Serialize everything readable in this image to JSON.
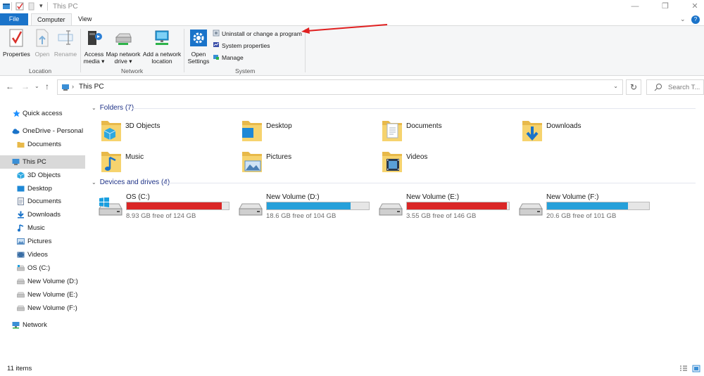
{
  "window": {
    "title": "This PC",
    "controls": [
      "minimize-icon",
      "restore-icon",
      "close-icon"
    ]
  },
  "ribbon": {
    "tabs": [
      {
        "label": "File",
        "state": "file"
      },
      {
        "label": "Computer",
        "state": "active"
      },
      {
        "label": "View",
        "state": "normal"
      }
    ],
    "groups": {
      "location": {
        "label": "Location",
        "buttons": [
          {
            "label": "Properties",
            "icon": "properties-icon",
            "enabled": true
          },
          {
            "label": "Open",
            "icon": "open-icon",
            "enabled": false
          },
          {
            "label": "Rename",
            "icon": "rename-icon",
            "enabled": false
          }
        ]
      },
      "network": {
        "label": "Network",
        "buttons": [
          {
            "line1": "Access",
            "line2": "media ▾",
            "icon": "access-media-icon"
          },
          {
            "line1": "Map network",
            "line2": "drive ▾",
            "icon": "map-drive-icon"
          },
          {
            "line1": "Add a network",
            "line2": "location",
            "icon": "network-location-icon"
          }
        ]
      },
      "system": {
        "label": "System",
        "open_settings": {
          "line1": "Open",
          "line2": "Settings",
          "icon": "gear-icon"
        },
        "commands": [
          {
            "label": "Uninstall or change a program",
            "icon": "uninstall-icon"
          },
          {
            "label": "System properties",
            "icon": "system-properties-icon"
          },
          {
            "label": "Manage",
            "icon": "manage-icon"
          }
        ]
      }
    }
  },
  "address": {
    "location": "This PC",
    "search_placeholder": "Search T..."
  },
  "sidebar": {
    "items": [
      {
        "label": "Quick access",
        "icon": "star-icon",
        "color": "#1e90ff"
      },
      {
        "label": "OneDrive - Personal",
        "icon": "cloud-icon",
        "color": "#1a73c9"
      },
      {
        "label": "Documents",
        "icon": "folder-icon",
        "color": "#e8b94a"
      },
      {
        "label": "This PC",
        "icon": "computer-icon",
        "color": "#3a8fd6"
      },
      {
        "label": "3D Objects",
        "icon": "cube-icon",
        "color": "#2ea8e0"
      },
      {
        "label": "Desktop",
        "icon": "desktop-icon",
        "color": "#1e88d6"
      },
      {
        "label": "Documents",
        "icon": "documents-icon",
        "color": "#7a8aa3"
      },
      {
        "label": "Downloads",
        "icon": "download-icon",
        "color": "#1a73c9"
      },
      {
        "label": "Music",
        "icon": "music-icon",
        "color": "#1a73c9"
      },
      {
        "label": "Pictures",
        "icon": "pictures-icon",
        "color": "#5b8fc4"
      },
      {
        "label": "Videos",
        "icon": "videos-icon",
        "color": "#3a6ea5"
      },
      {
        "label": "OS (C:)",
        "icon": "drive-icon",
        "color": "#9aa3ad"
      },
      {
        "label": "New Volume (D:)",
        "icon": "drive-icon",
        "color": "#9aa3ad"
      },
      {
        "label": "New Volume (E:)",
        "icon": "drive-icon",
        "color": "#9aa3ad"
      },
      {
        "label": "New Volume (F:)",
        "icon": "drive-icon",
        "color": "#9aa3ad"
      },
      {
        "label": "Network",
        "icon": "network-icon",
        "color": "#3a8fd6"
      }
    ]
  },
  "folders_section": {
    "heading": "Folders (7)",
    "items": [
      {
        "label": "3D Objects",
        "icon": "3d-objects-folder-icon"
      },
      {
        "label": "Desktop",
        "icon": "desktop-folder-icon"
      },
      {
        "label": "Documents",
        "icon": "documents-folder-icon"
      },
      {
        "label": "Downloads",
        "icon": "downloads-folder-icon"
      },
      {
        "label": "Music",
        "icon": "music-folder-icon"
      },
      {
        "label": "Pictures",
        "icon": "pictures-folder-icon"
      },
      {
        "label": "Videos",
        "icon": "videos-folder-icon"
      }
    ]
  },
  "drives_section": {
    "heading": "Devices and drives (4)",
    "items": [
      {
        "name": "OS (C:)",
        "free": "8.93 GB free of 124 GB",
        "used_fraction": 0.928,
        "bar_color": "#da2626",
        "icon": "windows-drive-icon"
      },
      {
        "name": "New Volume (D:)",
        "free": "18.6 GB free of 104 GB",
        "used_fraction": 0.821,
        "bar_color": "#26a0da",
        "icon": "drive-icon"
      },
      {
        "name": "New Volume (E:)",
        "free": "3.55 GB free of 146 GB",
        "used_fraction": 0.976,
        "bar_color": "#da2626",
        "icon": "drive-icon"
      },
      {
        "name": "New Volume (F:)",
        "free": "20.6 GB free of 101 GB",
        "used_fraction": 0.796,
        "bar_color": "#26a0da",
        "icon": "drive-icon"
      }
    ]
  },
  "status": {
    "items_count": "11 items"
  },
  "annotation": {
    "arrow_color": "#e02020"
  }
}
